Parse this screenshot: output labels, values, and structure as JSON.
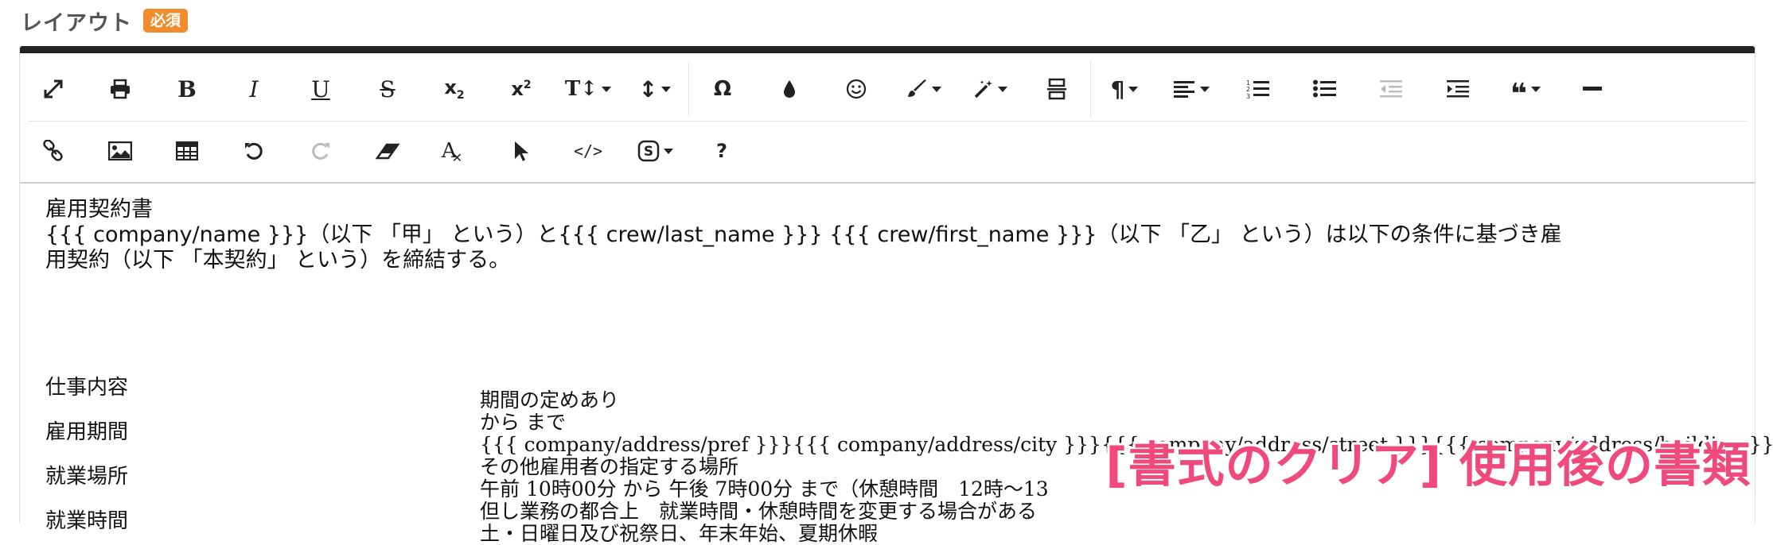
{
  "field": {
    "label": "レイアウト",
    "required_badge": "必須"
  },
  "toolbar": {
    "row1": [
      {
        "name": "fullscreen-icon",
        "glyph": "⤢"
      },
      {
        "name": "print-icon",
        "glyph": "🖶"
      },
      {
        "name": "bold-icon",
        "glyph": "B"
      },
      {
        "name": "italic-icon",
        "glyph": "I"
      },
      {
        "name": "underline-icon",
        "glyph": "U"
      },
      {
        "name": "strikethrough-icon",
        "glyph": "S"
      },
      {
        "name": "subscript-icon",
        "glyph": "x₂"
      },
      {
        "name": "superscript-icon",
        "glyph": "x²"
      },
      {
        "name": "font-size-icon",
        "glyph": "T↕"
      },
      {
        "name": "line-height-icon",
        "glyph": "↕"
      },
      {
        "name": "special-char-icon",
        "glyph": "Ω"
      },
      {
        "name": "color-drop-icon",
        "glyph": "💧"
      },
      {
        "name": "emoji-icon",
        "glyph": "☺"
      },
      {
        "name": "paint-brush-icon",
        "glyph": "🖌"
      },
      {
        "name": "magic-wand-icon",
        "glyph": "✨"
      },
      {
        "name": "page-break-icon",
        "glyph": "☰"
      },
      {
        "name": "paragraph-icon",
        "glyph": "¶"
      },
      {
        "name": "align-icon",
        "glyph": "≡"
      },
      {
        "name": "ordered-list-icon",
        "glyph": "1≡"
      },
      {
        "name": "unordered-list-icon",
        "glyph": "•≡"
      },
      {
        "name": "outdent-icon",
        "glyph": "⇤"
      },
      {
        "name": "indent-icon",
        "glyph": "⇥"
      },
      {
        "name": "quote-icon",
        "glyph": "❝"
      },
      {
        "name": "horizontal-rule-icon",
        "glyph": "—"
      }
    ],
    "row2": [
      {
        "name": "link-icon",
        "glyph": "🔗"
      },
      {
        "name": "image-icon",
        "glyph": "🖼"
      },
      {
        "name": "table-icon",
        "glyph": "▦"
      },
      {
        "name": "undo-icon",
        "glyph": "↶"
      },
      {
        "name": "redo-icon",
        "glyph": "↷"
      },
      {
        "name": "eraser-icon",
        "glyph": "⌫"
      },
      {
        "name": "clear-format-icon",
        "glyph": "A✕"
      },
      {
        "name": "select-cursor-icon",
        "glyph": "➤"
      },
      {
        "name": "code-view-icon",
        "glyph": "</>"
      },
      {
        "name": "symbol-dropdown-icon",
        "glyph": "Ⓢ"
      },
      {
        "name": "help-icon",
        "glyph": "?"
      }
    ]
  },
  "document": {
    "title": "雇用契約書",
    "intro_line1": "{{{ company/name }}}（以下 「甲」 という）と{{{ crew/last_name }}} {{{ crew/first_name }}}（以下 「乙」 という）は以下の条件に基づき雇",
    "intro_line2": "用契約（以下 「本契約」 という）を締結する。",
    "terms": {
      "labels": [
        "仕事内容",
        "雇用期間",
        "就業場所",
        "就業時間"
      ],
      "values": [
        "期間の定めあり",
        "から まで",
        "{{{ company/address/pref }}}{{{ company/address/city }}}{{{ company/address/street }}}{{{ company/address/building }}}、",
        "その他雇用者の指定する場所",
        "午前 10時00分 から 午後 7時00分 まで（休憩時間　12時〜13",
        "但し業務の都合上　就業時間・休憩時間を変更する場合がある",
        "土・日曜日及び祝祭日、年末年始、夏期休暇"
      ]
    }
  },
  "overlay_caption": "[書式のクリア] 使用後の書類",
  "colors": {
    "badge": "#f08c2c",
    "caption": "#f04a7c",
    "topbar": "#222222"
  }
}
